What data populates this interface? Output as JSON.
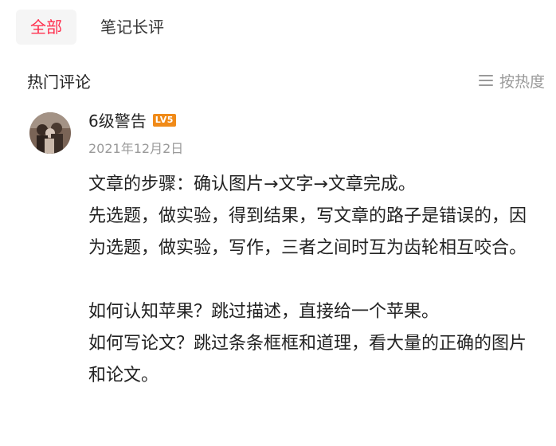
{
  "tabs": {
    "all": "全部",
    "notes": "笔记长评"
  },
  "section": {
    "title": "热门评论",
    "sort_label": "按热度"
  },
  "comment": {
    "username": "6级警告",
    "level": "LV5",
    "date": "2021年12月2日",
    "paragraphs": [
      "文章的步骤：确认图片→文字→文章完成。",
      "先选题，做实验，得到结果，写文章的路子是错误的，因为选题，做实验，写作，三者之间时互为齿轮相互咬合。",
      "如何认知苹果？跳过描述，直接给一个苹果。",
      "如何写论文？跳过条条框框和道理，看大量的正确的图片和论文。"
    ]
  },
  "colors": {
    "accent": "#ff2e4d",
    "tab_bg": "#f5f5f5",
    "badge": "#f08a18",
    "muted": "#999999"
  }
}
